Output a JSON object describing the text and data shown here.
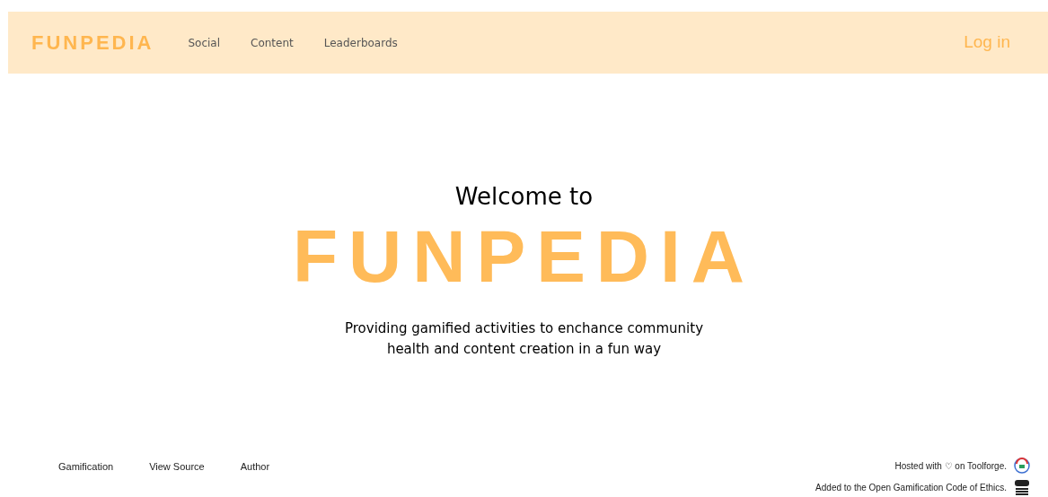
{
  "header": {
    "logo": "FUNPEDIA",
    "nav": [
      "Social",
      "Content",
      "Leaderboards"
    ],
    "login": "Log in"
  },
  "hero": {
    "welcome": "Welcome to",
    "title": "FUNPEDIA",
    "tagline": "Providing gamified activities to enchance community health and content creation in a fun way"
  },
  "footer": {
    "links": [
      "Gamification",
      "View Source",
      "Author"
    ],
    "credits": [
      {
        "kind": "toolforge",
        "text": "Hosted with ♡ on Toolforge."
      },
      {
        "kind": "ogce",
        "text": "Added to the Open Gamification Code of Ethics."
      }
    ]
  }
}
